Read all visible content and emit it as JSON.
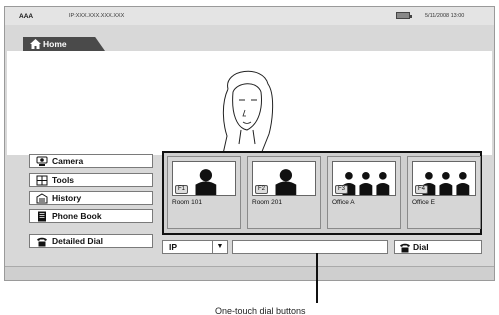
{
  "status": {
    "name": "AAA",
    "ip": "IP:XXX.XXX.XXX.XXX",
    "datetime": "5/11/2008 13:00"
  },
  "home_tab": {
    "label": "Home"
  },
  "menu": {
    "items": [
      {
        "label": "Camera",
        "icon": "camera-icon"
      },
      {
        "label": "Tools",
        "icon": "tools-icon"
      },
      {
        "label": "History",
        "icon": "history-icon"
      },
      {
        "label": "Phone Book",
        "icon": "phone-book-icon"
      },
      {
        "label": "Detailed Dial",
        "icon": "phone-icon"
      }
    ]
  },
  "thumbnails": [
    {
      "fkey": "F1",
      "label": "Room 101",
      "people": 1
    },
    {
      "fkey": "F2",
      "label": "Room 201",
      "people": 1
    },
    {
      "fkey": "F3",
      "label": "Office A",
      "people": 3
    },
    {
      "fkey": "F4",
      "label": "Office E",
      "people": 3
    }
  ],
  "dial": {
    "protocol": "IP",
    "input_value": "",
    "button_label": "Dial"
  },
  "caption": {
    "text": "One-touch dial buttons"
  },
  "colors": {
    "tab_bg": "#4a4a4a",
    "screen_bg": "#d8d8d8",
    "panel_border": "#111111"
  }
}
